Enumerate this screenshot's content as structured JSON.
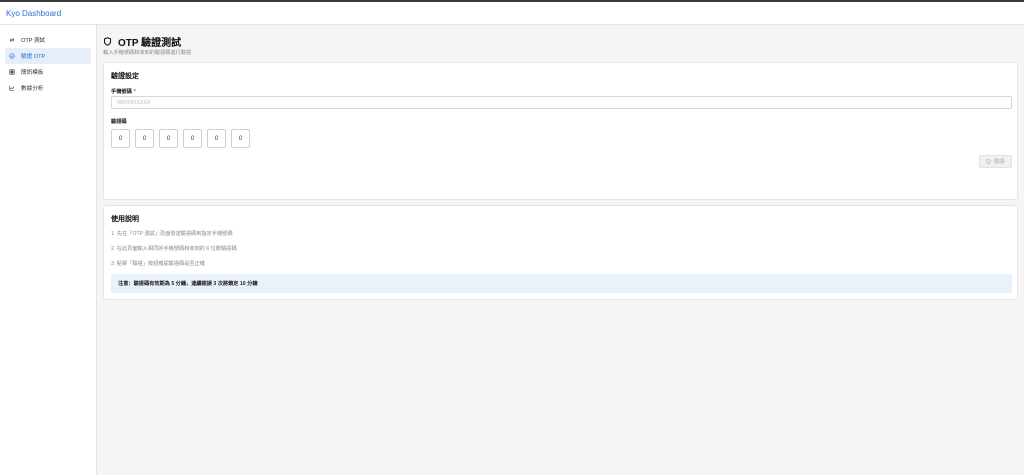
{
  "app": {
    "brand": "Kyo Dashboard"
  },
  "sidebar": {
    "items": [
      {
        "label": "OTP 測試",
        "icon": "link-icon",
        "active": false
      },
      {
        "label": "驗證 OTP",
        "icon": "check-circle-icon",
        "active": true
      },
      {
        "label": "簡訊模板",
        "icon": "template-icon",
        "active": false
      },
      {
        "label": "數據分析",
        "icon": "chart-icon",
        "active": false
      }
    ]
  },
  "page": {
    "title": "OTP 驗證測試",
    "title_icon": "shield-icon",
    "subtitle": "輸入手機號碼和收到的驗證碼進行驗證"
  },
  "verify_card": {
    "title": "驗證設定",
    "phone_label": "手機號碼",
    "required_mark": "*",
    "phone_placeholder": "09XXXXXXXX",
    "phone_value": "",
    "code_label": "驗證碼",
    "code_boxes": [
      "0",
      "0",
      "0",
      "0",
      "0",
      "0"
    ],
    "verify_button": "驗證"
  },
  "help_card": {
    "title": "使用說明",
    "steps": [
      "1. 先在「OTP 測試」頁面發送驗證碼到指定手機號碼",
      "2. 在此頁面輸入相同的手機號碼和收到的 6 位數驗證碼",
      "3. 點擊「驗證」按鈕確認驗證碼是否正確"
    ],
    "notice": "注意：驗證碼有效期為 5 分鐘，連續錯誤 3 次將鎖定 10 分鐘"
  },
  "colors": {
    "accent": "#2f6fd0",
    "active_nav_bg": "#e6eef9",
    "notice_bg": "#e9f1fb"
  }
}
